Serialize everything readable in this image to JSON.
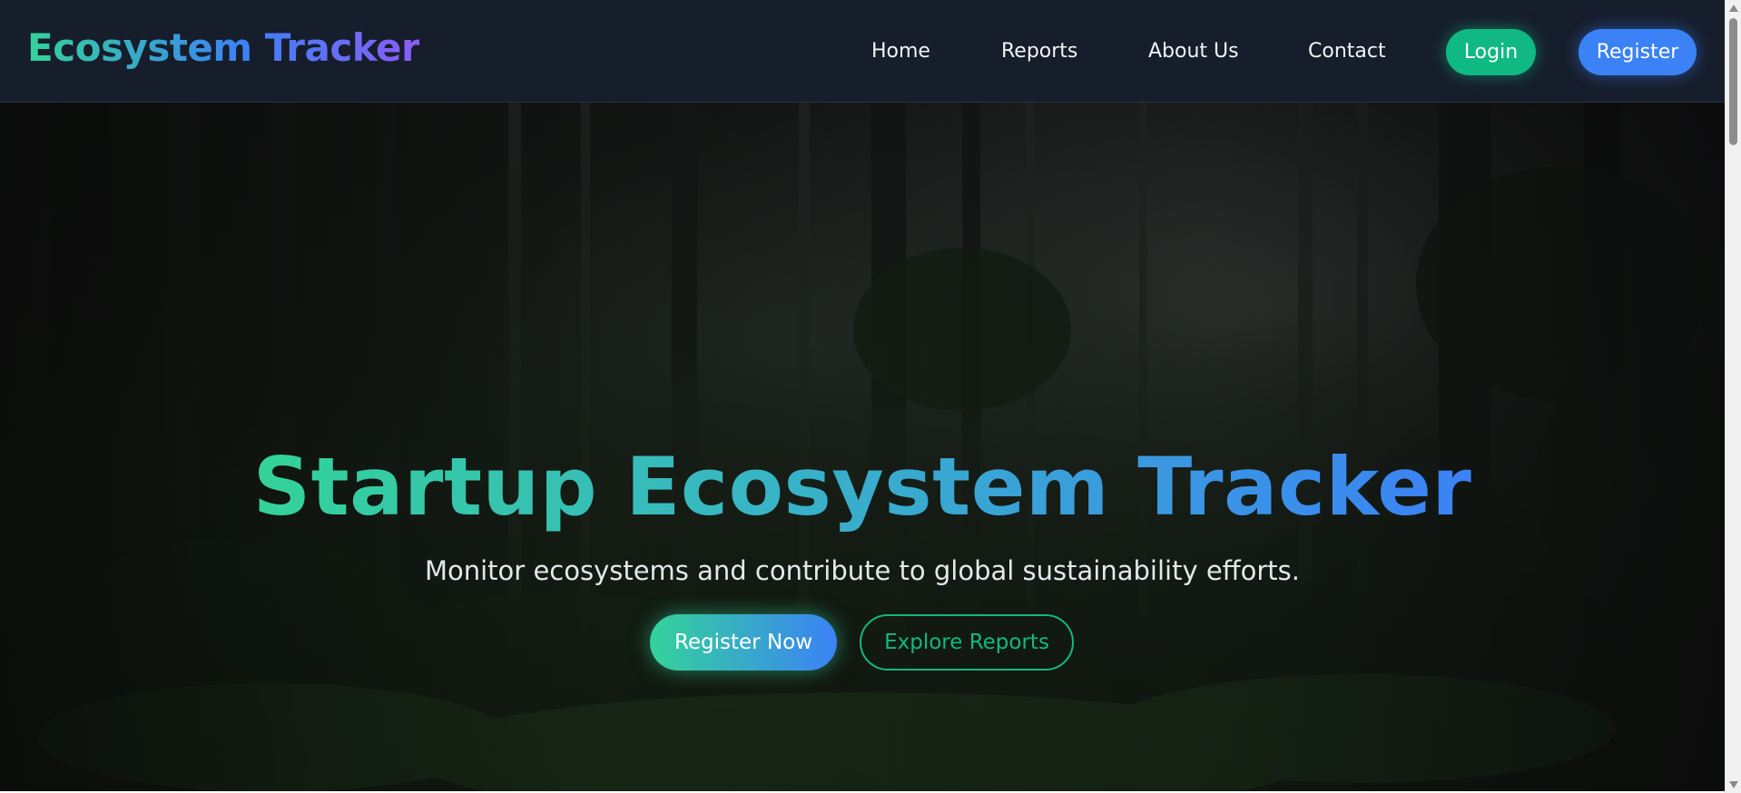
{
  "navbar": {
    "brand": "Ecosystem Tracker",
    "links": [
      "Home",
      "Reports",
      "About Us",
      "Contact"
    ],
    "login_label": "Login",
    "register_label": "Register"
  },
  "hero": {
    "title": "Startup Ecosystem Tracker",
    "subtitle": "Monitor ecosystems and contribute to global sustainability efforts.",
    "primary_cta": "Register Now",
    "secondary_cta": "Explore Reports",
    "background": "forest-scene-image"
  },
  "icons": {
    "scroll_up": "chevron-up-icon",
    "scroll_down": "chevron-down-icon"
  },
  "colors": {
    "navbar_bg": "#161d2b",
    "accent_green": "#10b981",
    "accent_blue": "#3b82f6",
    "accent_purple": "#8b5cf6",
    "gradient_start": "#34d399"
  }
}
